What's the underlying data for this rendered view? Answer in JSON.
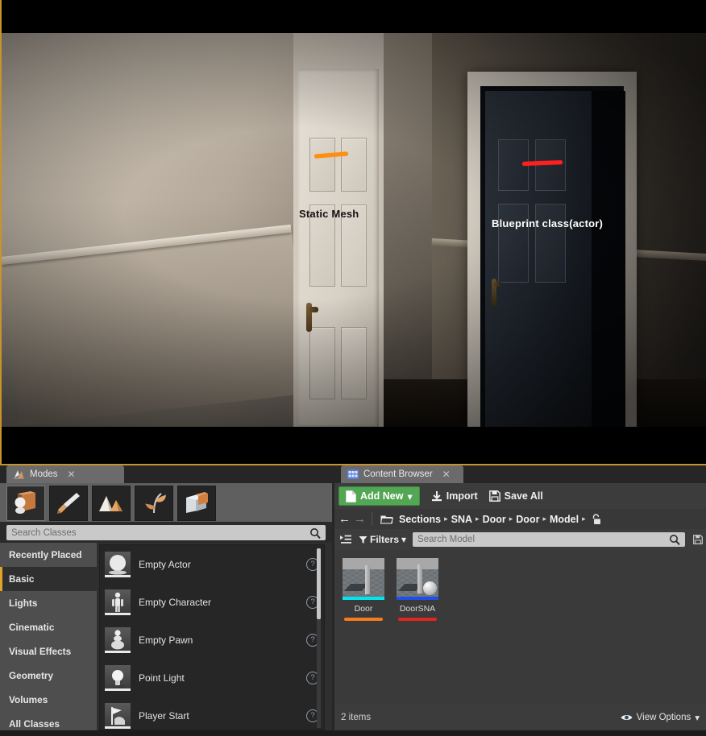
{
  "viewport": {
    "annotations": [
      {
        "id": "static-mesh",
        "label": "Static Mesh",
        "stroke_color": "#ff8f10"
      },
      {
        "id": "blueprint-class",
        "label": "Blueprint class(actor)",
        "stroke_color": "#fe2020"
      }
    ],
    "active_border_color": "#c8922c"
  },
  "modes": {
    "tab_label": "Modes",
    "tab_icon": "modes-icon",
    "close_icon": "close-icon",
    "toolbar": [
      {
        "name": "place-mode",
        "icon": "place-box-icon",
        "selected": true
      },
      {
        "name": "paint-mode",
        "icon": "paint-brush-icon",
        "selected": false
      },
      {
        "name": "landscape-mode",
        "icon": "landscape-icon",
        "selected": false
      },
      {
        "name": "foliage-mode",
        "icon": "foliage-leaf-icon",
        "selected": false
      },
      {
        "name": "geometry-editing-mode",
        "icon": "geometry-box-icon",
        "selected": false
      }
    ],
    "search": {
      "placeholder": "Search Classes",
      "value": "",
      "icon": "search-icon"
    },
    "categories": [
      {
        "label": "Recently Placed",
        "active": false
      },
      {
        "label": "Basic",
        "active": true
      },
      {
        "label": "Lights",
        "active": false
      },
      {
        "label": "Cinematic",
        "active": false
      },
      {
        "label": "Visual Effects",
        "active": false
      },
      {
        "label": "Geometry",
        "active": false
      },
      {
        "label": "Volumes",
        "active": false
      },
      {
        "label": "All Classes",
        "active": false
      }
    ],
    "assets": [
      {
        "label": "Empty Actor",
        "icon": "sphere-thumbnail",
        "help_icon": "help-icon"
      },
      {
        "label": "Empty Character",
        "icon": "character-thumbnail",
        "help_icon": "help-icon"
      },
      {
        "label": "Empty Pawn",
        "icon": "pawn-thumbnail",
        "help_icon": "help-icon"
      },
      {
        "label": "Point Light",
        "icon": "lightbulb-thumbnail",
        "help_icon": "help-icon"
      },
      {
        "label": "Player Start",
        "icon": "player-start-thumbnail",
        "help_icon": "help-icon"
      }
    ]
  },
  "content_browser": {
    "tab_label": "Content Browser",
    "tab_icon": "content-browser-icon",
    "close_icon": "close-icon",
    "toolbar": {
      "add_new_label": "Add New",
      "add_new_icon": "new-document-icon",
      "add_new_caret": "▾",
      "add_new_color": "#53a653",
      "import_label": "Import",
      "import_icon": "import-download-icon",
      "save_all_label": "Save All",
      "save_all_icon": "save-disk-icon"
    },
    "navigation": {
      "back_icon": "arrow-left-icon",
      "forward_icon": "arrow-right-icon",
      "folder_icon": "folder-open-icon",
      "lock_icon": "lock-open-icon",
      "breadcrumbs": [
        "Sections",
        "SNA",
        "Door",
        "Door",
        "Model"
      ],
      "separator": "▸"
    },
    "filter_bar": {
      "sources_icon": "sources-panel-icon",
      "filters_label": "Filters",
      "filters_icon": "filter-funnel-icon",
      "filters_caret": "▾",
      "search": {
        "placeholder": "Search Model",
        "value": "",
        "icon": "search-icon"
      },
      "save_search_icon": "save-disk-icon"
    },
    "assets": [
      {
        "name": "Door",
        "type_color": "#00e5ee",
        "underline_color": "#f57c1f",
        "has_sphere": false
      },
      {
        "name": "DoorSNA",
        "type_color": "#1e4fe8",
        "underline_color": "#e32424",
        "has_sphere": true
      }
    ],
    "status": {
      "item_count": "2 items",
      "view_options_label": "View Options",
      "view_options_icon": "eye-icon",
      "view_options_caret": "▾"
    }
  }
}
